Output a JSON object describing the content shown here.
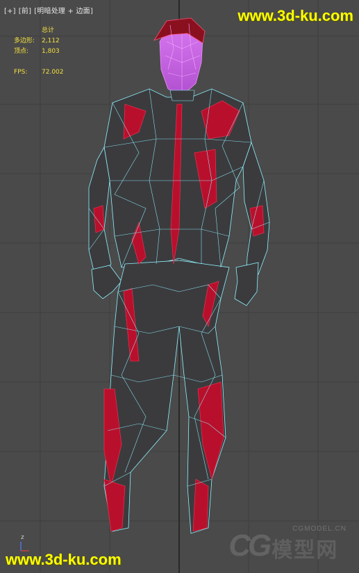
{
  "viewport": {
    "label_parts": [
      "[+]",
      "[前]",
      "[明暗处理 + 边面]"
    ]
  },
  "stats": {
    "total_label": "总计",
    "poly_label": "多边形:",
    "poly_value": "2,112",
    "vert_label": "顶点:",
    "vert_value": "1,803",
    "fps_label": "FPS:",
    "fps_value": "72.002"
  },
  "watermarks": {
    "top": "www.3d-ku.com",
    "bottom": "www.3d-ku.com",
    "cg_small": "CGMODEL.CN",
    "cg_big": "模型网",
    "cg_letters": "CG"
  },
  "axis": {
    "z_label": "z"
  },
  "colors": {
    "grid": "#5a5a5a",
    "wire": "#8ff3ff",
    "body": "#3a3a3c",
    "accent": "#c01030",
    "head_wire": "#e060ff"
  }
}
